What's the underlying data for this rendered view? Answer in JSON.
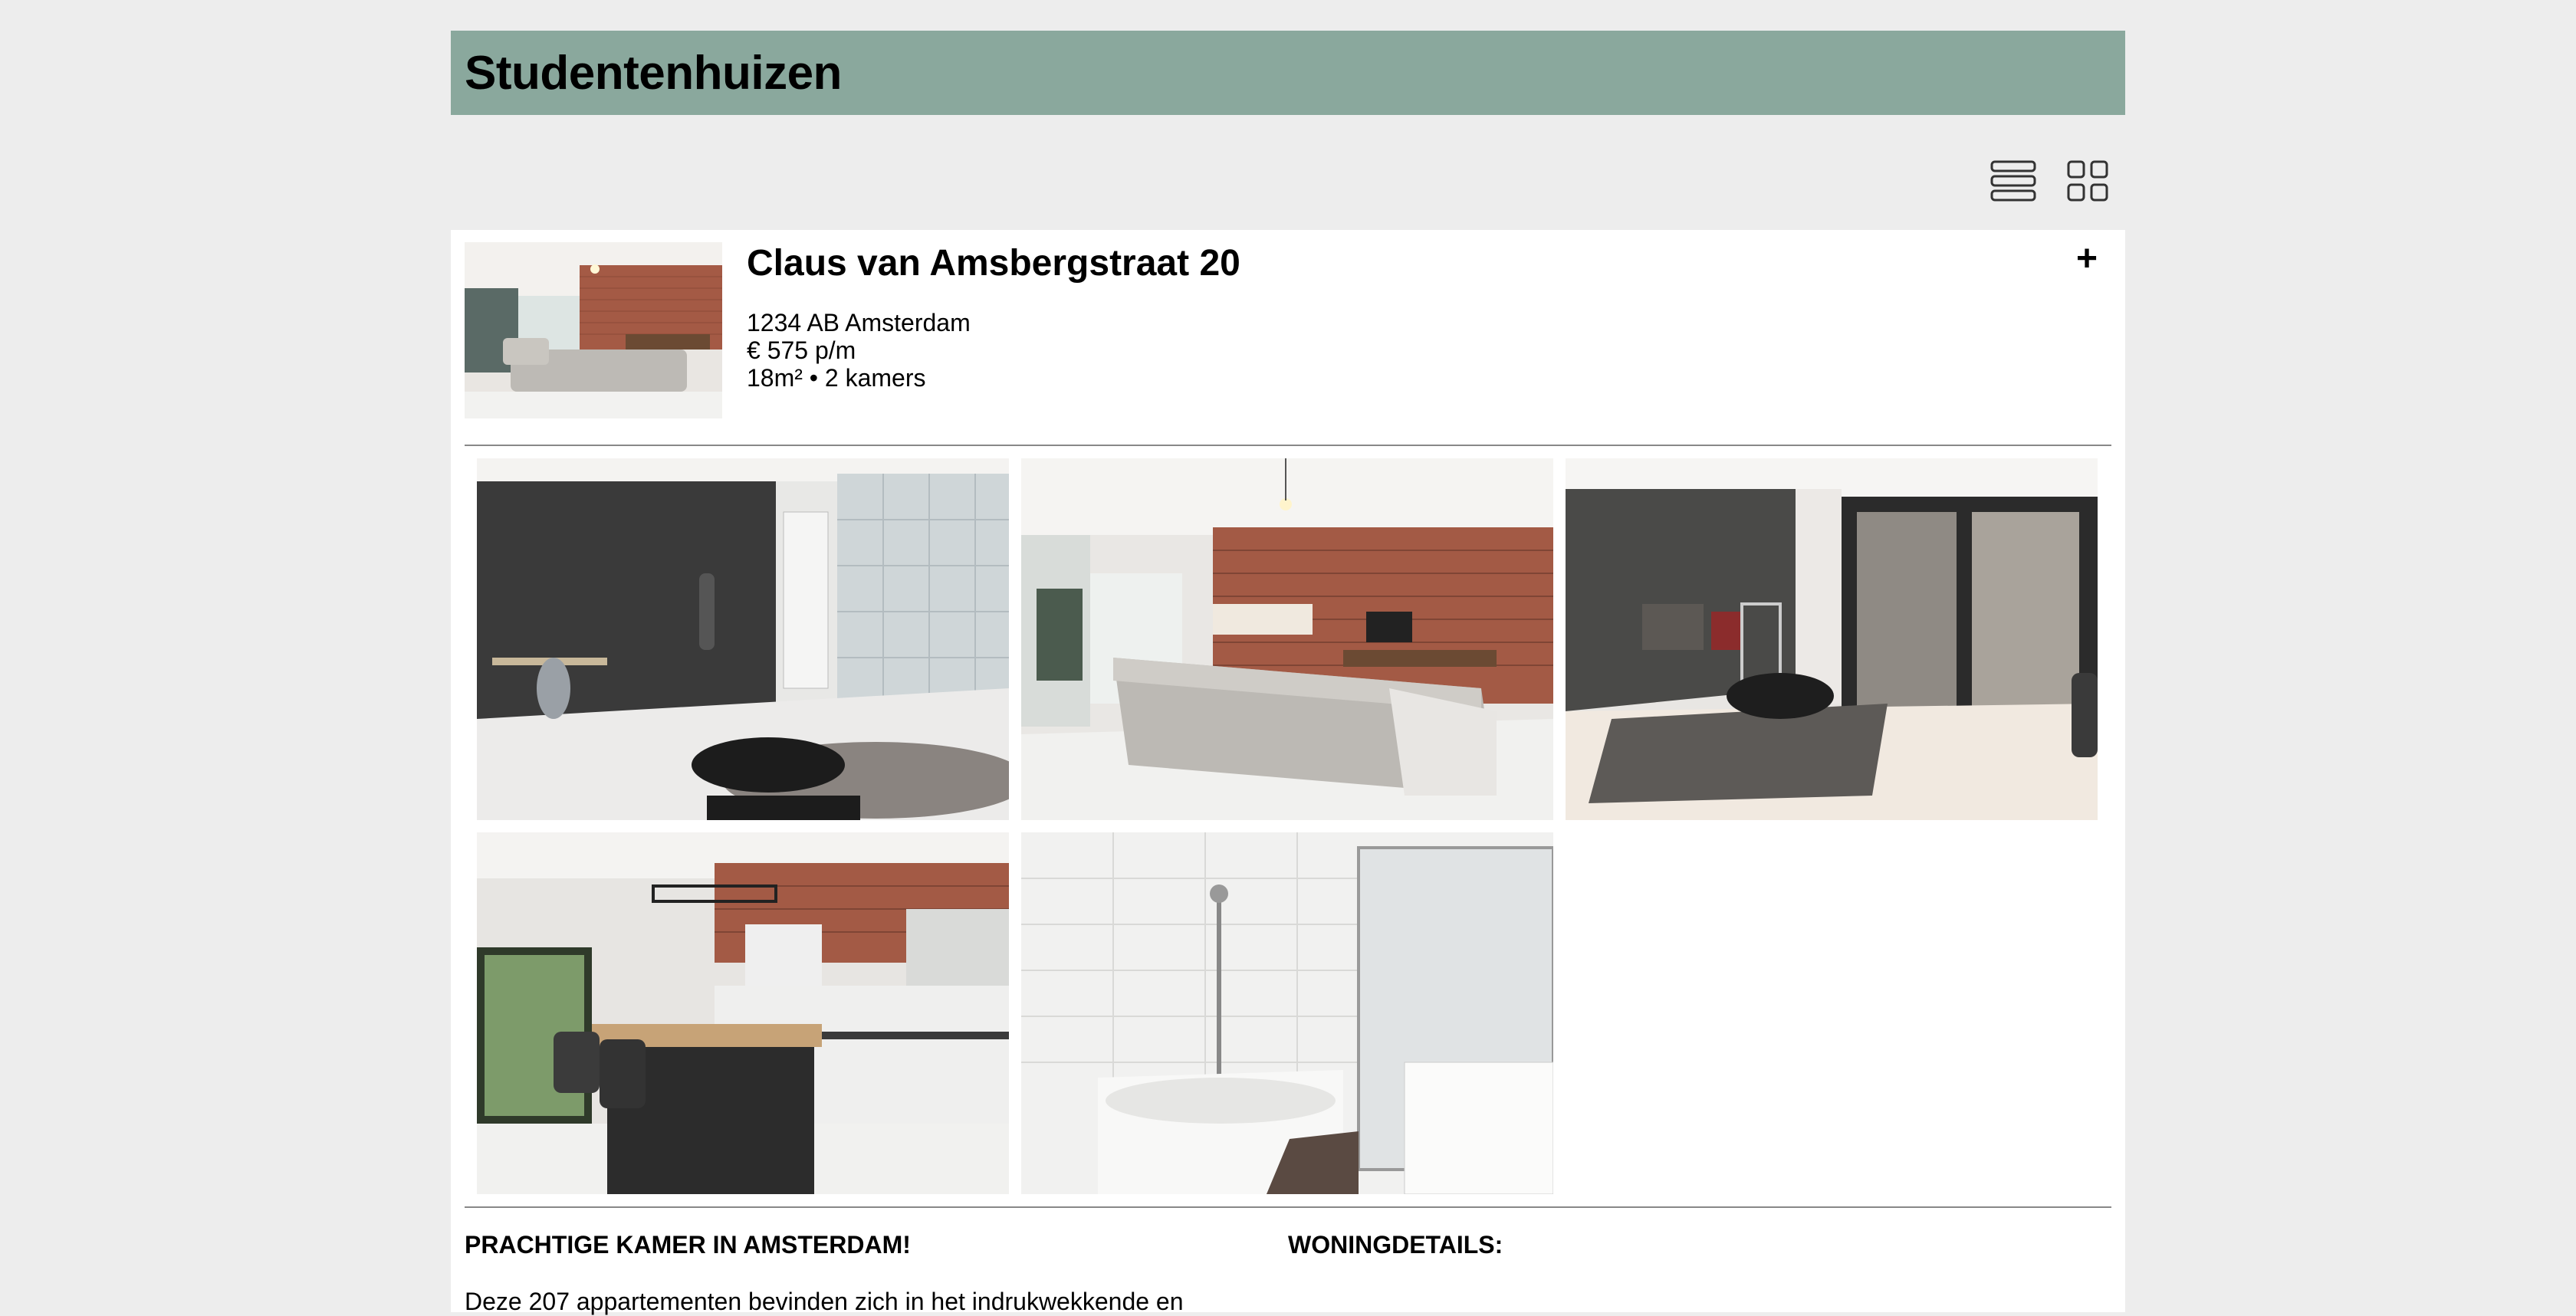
{
  "header": {
    "title": "Studentenhuizen"
  },
  "toolbar": {
    "list_view_icon": "list-view-icon",
    "grid_view_icon": "grid-view-icon"
  },
  "listing": {
    "address": "Claus van Amsbergstraat 20",
    "postal_city": "1234 AB Amsterdam",
    "price": "€ 575 p/m",
    "size_rooms": "18m² • 2 kamers",
    "expand_label": "+"
  },
  "gallery": {
    "photos": [
      "workroom",
      "living-room",
      "lounge",
      "kitchen",
      "bathroom"
    ]
  },
  "description": {
    "heading": "PRACHTIGE KAMER IN AMSTERDAM!",
    "text": "Deze 207 appartementen bevinden zich in het indrukwekkende en"
  },
  "details": {
    "heading": "WONINGDETAILS:"
  },
  "colors": {
    "header_bg": "#8aa89d",
    "page_bg": "#ededed"
  }
}
